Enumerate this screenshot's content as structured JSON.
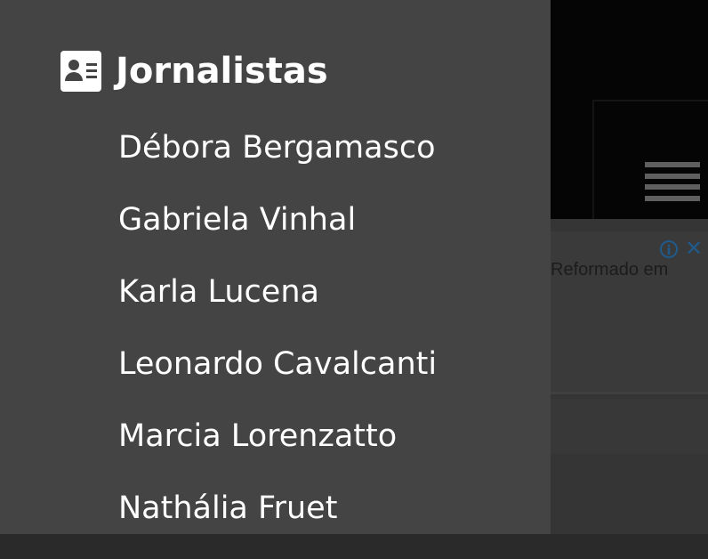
{
  "drawer": {
    "section_icon": "contact-card-icon",
    "section_title": "Jornalistas",
    "items": [
      {
        "label": "Débora Bergamasco"
      },
      {
        "label": "Gabriela Vinhal"
      },
      {
        "label": "Karla Lucena"
      },
      {
        "label": "Leonardo Cavalcanti"
      },
      {
        "label": "Marcia Lorenzatto"
      },
      {
        "label": "Nathália Fruet"
      }
    ]
  },
  "background": {
    "menu_icon": "hamburger-icon",
    "ad": {
      "info_icon": "info-icon",
      "close_icon": "close-icon",
      "text": "Reformado em"
    }
  },
  "colors": {
    "drawer_bg": "#444444",
    "text": "#ffffff",
    "overlay_bg": "#2a2a2a",
    "ad_icon": "#1f5a8a"
  }
}
